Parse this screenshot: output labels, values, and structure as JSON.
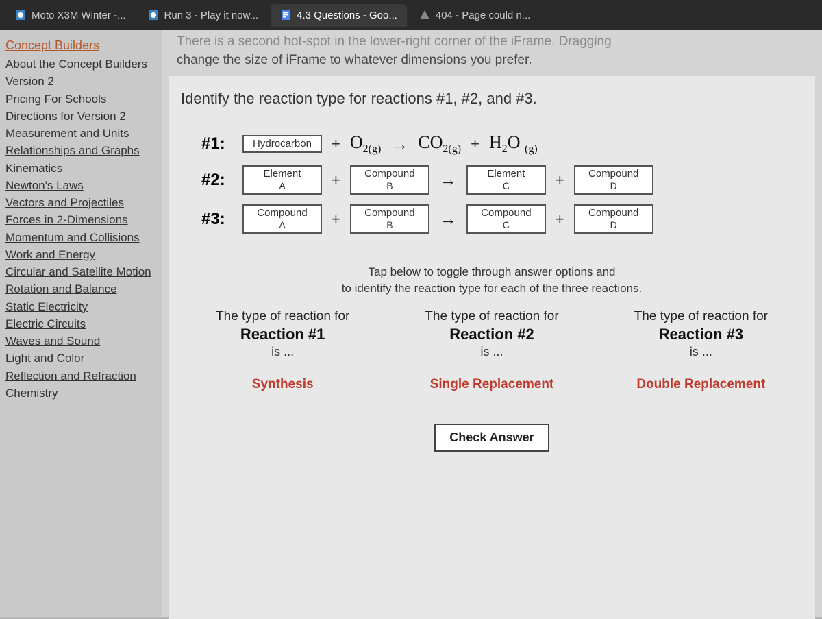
{
  "tabs": [
    {
      "label": "Moto X3M Winter -...",
      "icon": "game"
    },
    {
      "label": "Run 3 - Play it now...",
      "icon": "game"
    },
    {
      "label": "4.3 Questions - Goo...",
      "icon": "doc"
    },
    {
      "label": "404 - Page could n...",
      "icon": "warn"
    }
  ],
  "banner": {
    "faded": "There is a second hot-spot in the lower-right corner of the iFrame. Dragging",
    "line2": "change the size of iFrame to whatever dimensions you prefer."
  },
  "sidebar": {
    "title": "Concept Builders",
    "items": [
      "About the Concept Builders",
      "Version 2",
      "Pricing For Schools",
      "Directions for Version 2",
      "Measurement and Units",
      "Relationships and Graphs",
      "Kinematics",
      "Newton's Laws",
      "Vectors and Projectiles",
      "Forces in 2-Dimensions",
      "Momentum and Collisions",
      "Work and Energy",
      "Circular and Satellite Motion",
      "Rotation and Balance",
      "Static Electricity",
      "Electric Circuits",
      "Waves and Sound",
      "Light and Color",
      "Reflection and Refraction",
      "Chemistry"
    ]
  },
  "prompt": "Identify the reaction type for reactions #1, #2, and #3.",
  "rows": [
    {
      "num": "#1:",
      "a": {
        "t": "Hydrocarbon",
        "s": ""
      },
      "b": {
        "chem": "O",
        "sub": "2(g)"
      },
      "c": {
        "chem": "CO",
        "sub": "2(g)"
      },
      "d": {
        "chem": "H",
        "sub": "2",
        "tail": "O",
        "tsub": "(g)"
      }
    },
    {
      "num": "#2:",
      "a": {
        "t": "Element",
        "s": "A"
      },
      "b": {
        "t": "Compound",
        "s": "B"
      },
      "c": {
        "t": "Element",
        "s": "C"
      },
      "d": {
        "t": "Compound",
        "s": "D"
      }
    },
    {
      "num": "#3:",
      "a": {
        "t": "Compound",
        "s": "A"
      },
      "b": {
        "t": "Compound",
        "s": "B"
      },
      "c": {
        "t": "Compound",
        "s": "C"
      },
      "d": {
        "t": "Compound",
        "s": "D"
      }
    }
  ],
  "hint": {
    "l1": "Tap below to toggle through answer options and",
    "l2": "to identify the reaction type for each of the three reactions."
  },
  "answers": [
    {
      "lead": "The type of reaction for",
      "rx": "Reaction #1",
      "is": "is ...",
      "choice": "Synthesis"
    },
    {
      "lead": "The type of reaction for",
      "rx": "Reaction #2",
      "is": "is ...",
      "choice": "Single Replacement"
    },
    {
      "lead": "The type of reaction for",
      "rx": "Reaction #3",
      "is": "is ...",
      "choice": "Double Replacement"
    }
  ],
  "check": "Check Answer",
  "ops": {
    "plus": "+",
    "arrow": "→"
  }
}
